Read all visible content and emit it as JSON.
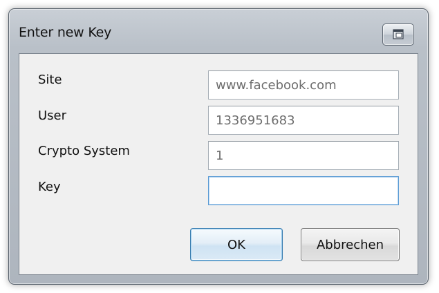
{
  "window": {
    "title": "Enter new Key",
    "restore_icon": "restore-icon"
  },
  "form": {
    "site_label": "Site",
    "site_value": "www.facebook.com",
    "user_label": "User",
    "user_value": "1336951683",
    "crypto_label": "Crypto System",
    "crypto_value": "1",
    "key_label": "Key",
    "key_value": ""
  },
  "buttons": {
    "ok_label": "OK",
    "cancel_label": "Abbrechen"
  },
  "colors": {
    "focus_border": "#5a9bd5",
    "default_button_border": "#3c7fb1"
  }
}
